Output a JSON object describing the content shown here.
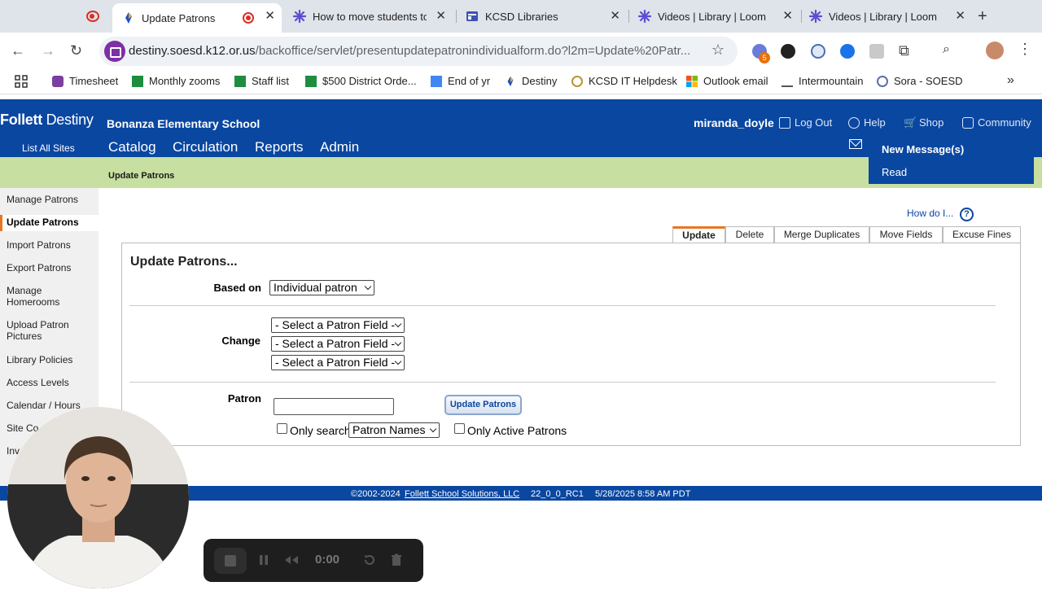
{
  "browser": {
    "tabs": [
      {
        "title": ""
      },
      {
        "title": "Update Patrons"
      },
      {
        "title": ""
      },
      {
        "title": "How to move students to"
      },
      {
        "title": "KCSD Libraries"
      },
      {
        "title": "Videos | Library | Loom"
      },
      {
        "title": "Videos | Library | Loom"
      }
    ],
    "url_host": "destiny.soesd.k12.or.us",
    "url_path": "/backoffice/servlet/presentupdatepatronindividualform.do?l2m=Update%20Patr...",
    "extension_badge": "5",
    "bookmarks": [
      "Timesheet",
      "Monthly zooms",
      "Staff list",
      "$500 District Orde...",
      "End of yr",
      "Destiny",
      "KCSD IT Helpdesk",
      "Outlook email",
      "Intermountain",
      "Sora - SOESD"
    ]
  },
  "destiny": {
    "logo_bold": "Follett",
    "logo_light": "Destiny",
    "school": "Bonanza Elementary School",
    "list_all_sites": "List All Sites",
    "nav": [
      "Catalog",
      "Circulation",
      "Reports",
      "Admin"
    ],
    "user": "miranda_doyle",
    "top_links": [
      "Log Out",
      "Help",
      "Shop",
      "Community"
    ],
    "messages": {
      "new": "New Message(s)",
      "read": "Read"
    },
    "breadcrumb": "Update Patrons",
    "sidebar": [
      "Manage Patrons",
      "Update Patrons",
      "Import Patrons",
      "Export Patrons",
      "Manage Homerooms",
      "Upload Patron Pictures",
      "Library Policies",
      "Access Levels",
      "Calendar / Hours",
      "Site Co",
      "Inv"
    ],
    "how_do_i": "How do I...",
    "help_glyph": "?",
    "tabs": [
      "Update",
      "Delete",
      "Merge Duplicates",
      "Move Fields",
      "Excuse Fines"
    ],
    "form": {
      "title": "Update Patrons...",
      "based_on_label": "Based on",
      "based_on_value": "Individual patron",
      "change_label": "Change",
      "field_select": "- Select a Patron Field -",
      "patron_label": "Patron",
      "patron_value": "",
      "update_button": "Update Patrons",
      "only_search_label": "Only search",
      "only_search_value": "Patron Names",
      "only_active_label": "Only Active Patrons"
    },
    "footer": {
      "copyright": "©2002-2024",
      "company": "Follett School Solutions, LLC",
      "version": "22_0_0_RC1",
      "timestamp": "5/28/2025 8:58 AM PDT"
    }
  },
  "recorder": {
    "time": "0:00"
  },
  "colors": {
    "destiny_blue": "#0a47a1",
    "crumb_green": "#c7dfa0",
    "accent_orange": "#e87722"
  }
}
